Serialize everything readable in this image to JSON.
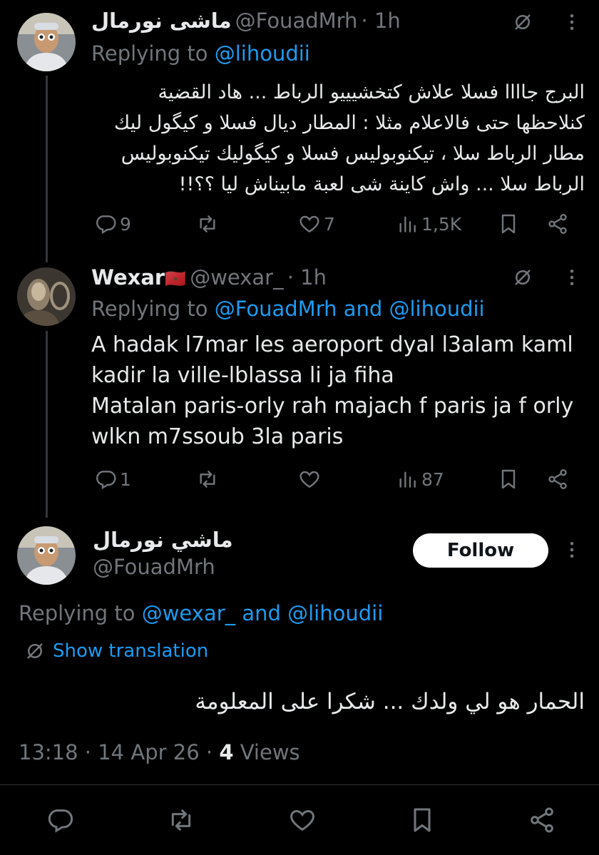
{
  "tweet1": {
    "display_name": "ماشى نورمال",
    "handle": "@FouadMrh",
    "time": "· 1h",
    "replying_prefix": "Replying to",
    "replying_to": "@lihoudii",
    "text_lines": [
      "البرج جاااا فسلا علاش كتخشيييو الرباط ... هاد القضية",
      "كنلاحظها حتى فالاعلام مثلا : المطار ديال فسلا و كيگول ليك",
      "مطار الرباط سلا ، تيكنوبوليس فسلا و كيگوليك تيكنوبوليس",
      "الرباط سلا ... واش كاينة شى لعبة مابيناش ليا ؟؟!!"
    ],
    "replies": "9",
    "retweets": "",
    "likes": "7",
    "views": "1,5K"
  },
  "tweet2": {
    "display_name": "Wexar",
    "flag": "🇲🇦",
    "handle": "@wexar_",
    "time": "· 1h",
    "replying_prefix": "Replying to",
    "replying_to": "@FouadMrh and @lihoudii",
    "text_lines": [
      "A hadak l7mar les aeroport dyal l3alam kaml",
      "kadir la ville-lblassa li ja fiha",
      "Matalan paris-orly rah majach f paris ja f orly",
      "wlkn m7ssoub 3la paris"
    ],
    "replies": "1",
    "retweets": "",
    "likes": "",
    "views": "87"
  },
  "main_tweet": {
    "display_name": "ماشي نورمال",
    "handle": "@FouadMrh",
    "follow_label": "Follow",
    "replying_prefix": "Replying to",
    "replying_to": "@wexar_ and @lihoudii",
    "translate_label": "Show translation",
    "text": "الحمار هو لي ولدك ... شكرا على المعلومة",
    "time": "13:18",
    "date": "· 14 Apr 26 ·",
    "views_count": "4",
    "views_label": "Views"
  },
  "icons": [
    "grok-icon",
    "more-icon",
    "reply-icon",
    "retweet-icon",
    "like-icon",
    "views-icon",
    "bookmark-icon",
    "share-icon",
    "translate-icon",
    "avatar"
  ],
  "colors": {
    "background": "#000000",
    "text": "#e7e9ea",
    "muted": "#71767b",
    "link": "#1d9bf0",
    "follow_bg": "#ffffff"
  }
}
